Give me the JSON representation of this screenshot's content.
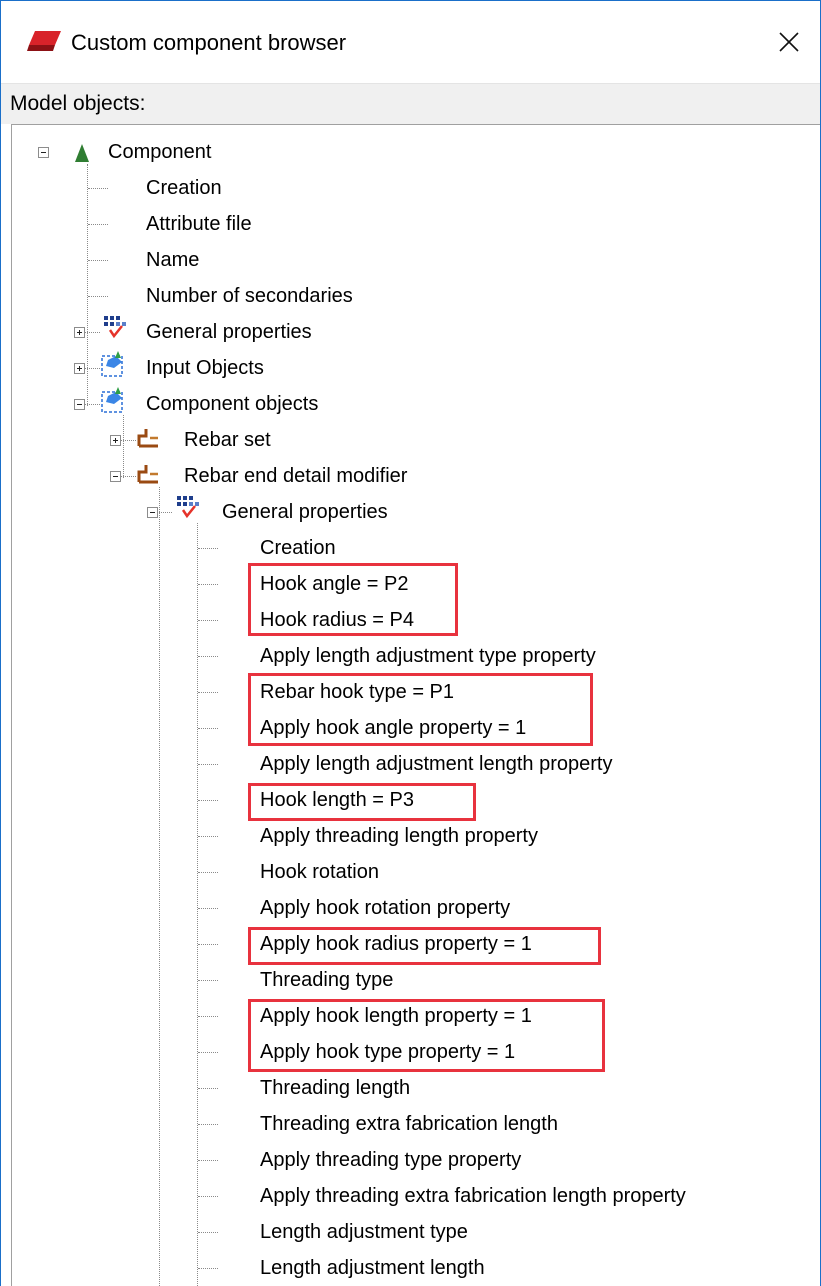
{
  "window": {
    "title": "Custom component browser",
    "close_symbol": "✕",
    "model_objects_label": "Model objects:"
  },
  "colors": {
    "highlight": "#e8323e",
    "window_border": "#1a6fc9",
    "label_bar": "#f0f0f0"
  },
  "tree": {
    "component": {
      "label": "Component",
      "icon": "green-triangle-component-icon",
      "children": [
        "Creation",
        "Attribute file",
        "Name",
        "Number of secondaries"
      ]
    },
    "general_properties": {
      "label": "General properties",
      "icon": "properties-icon"
    },
    "input_objects": {
      "label": "Input Objects",
      "icon": "objects-icon"
    },
    "component_objects": {
      "label": "Component objects",
      "icon": "objects-icon",
      "rebar_set": {
        "label": "Rebar set",
        "icon": "rebar-icon"
      },
      "rebar_end_detail_modifier": {
        "label": "Rebar end detail modifier",
        "icon": "rebar-icon",
        "general_properties": {
          "label": "General properties",
          "icon": "properties-icon",
          "properties": [
            "Creation",
            "Hook angle = P2",
            "Hook radius = P4",
            "Apply length adjustment type property",
            "Rebar hook type = P1",
            "Apply hook angle property = 1",
            "Apply length adjustment length property",
            "Hook length = P3",
            "Apply threading length property",
            "Hook rotation",
            "Apply hook rotation property",
            "Apply hook radius property = 1",
            "Threading type",
            "Apply hook length property = 1",
            "Apply hook type property = 1",
            "Threading length",
            "Threading extra fabrication length",
            "Apply threading type property",
            "Apply threading extra fabrication length property",
            "Length adjustment type",
            "Length adjustment length"
          ]
        }
      }
    }
  }
}
